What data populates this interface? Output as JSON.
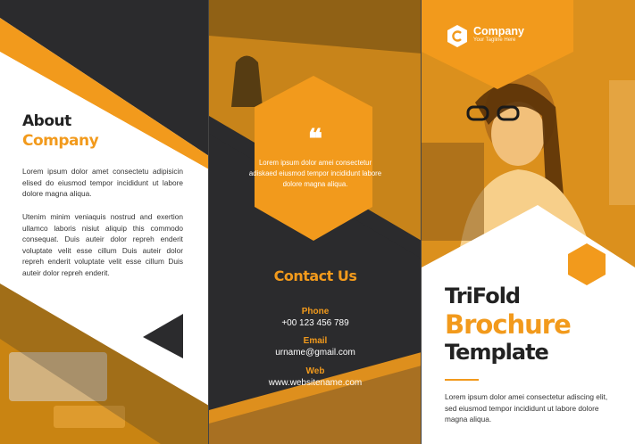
{
  "colors": {
    "accent": "#f29a1c",
    "dark": "#2b2b2d",
    "light": "#ffffff"
  },
  "left_panel": {
    "heading_line1": "About",
    "heading_line2": "Company",
    "paragraph1": "Lorem ipsum dolor amet consectetu adipisicin elised do eiusmod tempor incididunt ut labore dolore magna aliqua.",
    "paragraph2": "Utenim minim veniaquis nostrud and exertion ullamco laboris nisiut aliquip this commodo consequat. Duis auteir dolor repreh enderit voluptate velit esse cillum Duis auteir dolor repreh enderit voluptate velit esse cillum Duis auteir dolor repreh enderit."
  },
  "middle_panel": {
    "quote_mark": "❝",
    "quote_text": "Lorem ipsum dolor amei consectetur adiskaed eiusmod tempor incididunt labore dolore magna aliqua.",
    "contact_title": "Contact Us",
    "phone_label": "Phone",
    "phone": "+00 123 456 789",
    "email_label": "Email",
    "email": "urname@gmail.com",
    "web_label": "Web",
    "web": "www.websitename.com"
  },
  "right_panel": {
    "company_name": "Company",
    "tagline": "Your Tagline Here",
    "title_line1": "TriFold",
    "title_line2": "Brochure",
    "title_line3": "Template",
    "paragraph": "Lorem ipsum dolor amei consectetur adiscing elit, sed eiusmod tempor incididunt ut labore dolore magna aliqua."
  }
}
